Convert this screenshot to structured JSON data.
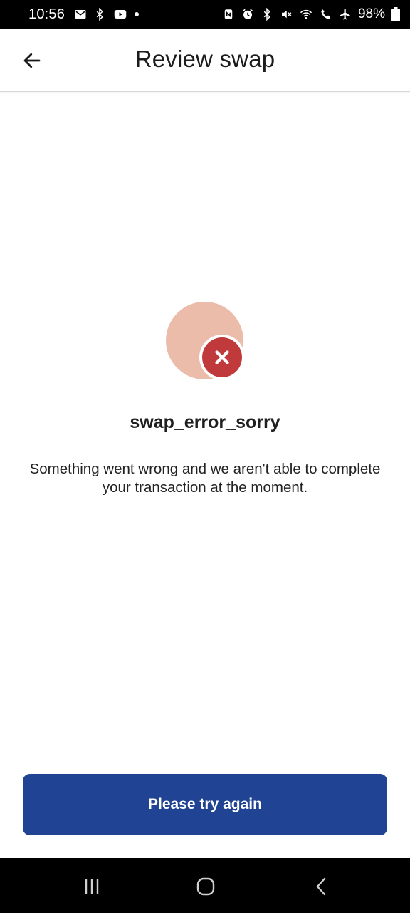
{
  "status_bar": {
    "time": "10:56",
    "battery": "98%",
    "left_icons": [
      "mail-icon",
      "bluetooth-icon",
      "youtube-icon",
      "notification-dot"
    ],
    "right_icons": [
      "nfc-icon",
      "alarm-icon",
      "bluetooth-icon",
      "mute-icon",
      "wifi-calling-icon",
      "wifi-calling-icon",
      "airplane-mode-icon",
      "battery-icon"
    ]
  },
  "app_bar": {
    "title": "Review swap",
    "back_icon": "arrow-left-icon"
  },
  "error": {
    "title": "swap_error_sorry",
    "message": "Something went wrong and we aren't able to complete your transaction at the moment.",
    "icon": "error-x-icon",
    "colors": {
      "circle": "#ecbcab",
      "badge": "#c0393b"
    }
  },
  "actions": {
    "retry_label": "Please try again",
    "color": "#214393"
  },
  "nav_bar": {
    "icons": [
      "recents-icon",
      "home-icon",
      "back-icon"
    ]
  }
}
